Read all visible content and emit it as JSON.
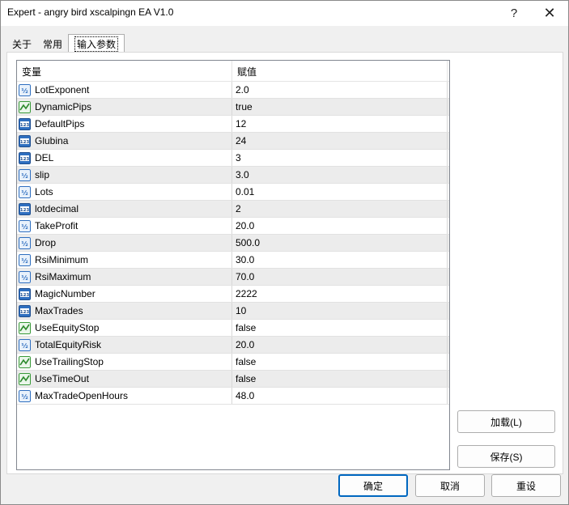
{
  "window": {
    "title": "Expert - angry bird xscalpingn EA V1.0",
    "help_glyph": "?",
    "close_glyph": "✕"
  },
  "tabs": [
    {
      "label": "关于"
    },
    {
      "label": "常用"
    },
    {
      "label": "输入参数"
    }
  ],
  "grid": {
    "headers": {
      "variable": "变量",
      "value": "赋值"
    },
    "rows": [
      {
        "name": "LotExponent",
        "value": "2.0",
        "icon": "double-icon"
      },
      {
        "name": "DynamicPips",
        "value": "true",
        "icon": "bool-icon"
      },
      {
        "name": "DefaultPips",
        "value": "12",
        "icon": "int-icon"
      },
      {
        "name": "Glubina",
        "value": "24",
        "icon": "int-icon"
      },
      {
        "name": "DEL",
        "value": "3",
        "icon": "int-icon"
      },
      {
        "name": "slip",
        "value": "3.0",
        "icon": "double-icon"
      },
      {
        "name": "Lots",
        "value": "0.01",
        "icon": "double-icon"
      },
      {
        "name": "lotdecimal",
        "value": "2",
        "icon": "int-icon"
      },
      {
        "name": "TakeProfit",
        "value": "20.0",
        "icon": "double-icon"
      },
      {
        "name": "Drop",
        "value": "500.0",
        "icon": "double-icon"
      },
      {
        "name": "RsiMinimum",
        "value": "30.0",
        "icon": "double-icon"
      },
      {
        "name": "RsiMaximum",
        "value": "70.0",
        "icon": "double-icon"
      },
      {
        "name": "MagicNumber",
        "value": "2222",
        "icon": "int-icon"
      },
      {
        "name": "MaxTrades",
        "value": "10",
        "icon": "int-icon"
      },
      {
        "name": "UseEquityStop",
        "value": "false",
        "icon": "bool-icon"
      },
      {
        "name": "TotalEquityRisk",
        "value": "20.0",
        "icon": "double-icon"
      },
      {
        "name": "UseTrailingStop",
        "value": "false",
        "icon": "bool-icon"
      },
      {
        "name": "UseTimeOut",
        "value": "false",
        "icon": "bool-icon"
      },
      {
        "name": "MaxTradeOpenHours",
        "value": "48.0",
        "icon": "double-icon"
      }
    ]
  },
  "buttons": {
    "load": "加载(L)",
    "save": "保存(S)",
    "ok": "确定",
    "cancel": "取消",
    "reset": "重设"
  },
  "colors": {
    "accent": "#0067c0",
    "row_alt": "#ececec",
    "icon_blue": "#2f6fc0",
    "icon_green": "#3a9a3a"
  }
}
